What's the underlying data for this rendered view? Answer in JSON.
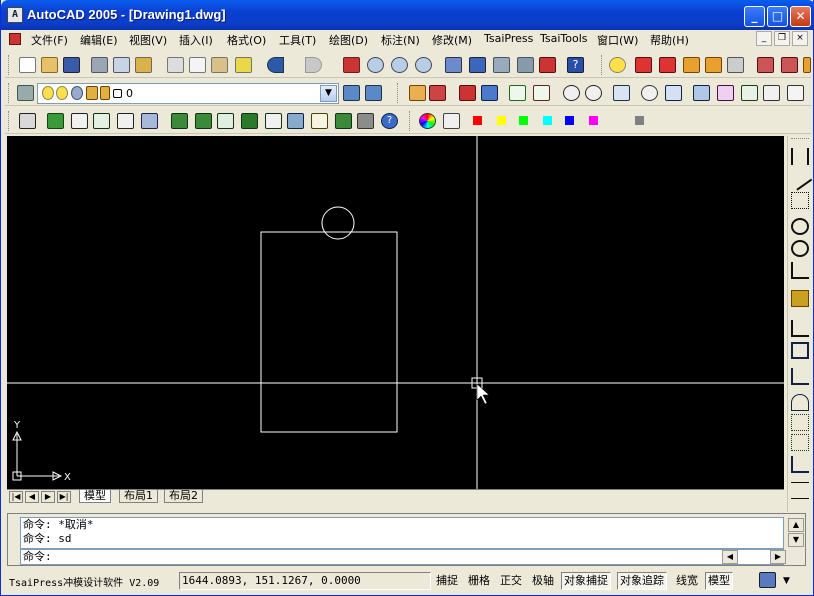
{
  "window": {
    "title": "AutoCAD 2005 - [Drawing1.dwg]",
    "app_icon": "autocad-icon"
  },
  "caption_buttons": {
    "minimize": "_",
    "maximize": "□",
    "close": "✕"
  },
  "menu": [
    "文件(F)",
    "编辑(E)",
    "视图(V)",
    "插入(I)",
    "格式(O)",
    "工具(T)",
    "绘图(D)",
    "标注(N)",
    "修改(M)",
    "TsaiPress",
    "TsaiTools",
    "窗口(W)",
    "帮助(H)"
  ],
  "mdi_buttons": {
    "minimize": "_",
    "restore": "❐",
    "close": "×"
  },
  "layer": {
    "current": "0"
  },
  "colors": {
    "swatches": [
      "#ff0000",
      "#ffff00",
      "#00ff00",
      "#00ffff",
      "#0000ff",
      "#ff00ff",
      "#808080"
    ],
    "canvas_bg": "#000000",
    "titlebar": "#0a4fd8"
  },
  "ucs": {
    "x_label": "X",
    "y_label": "Y"
  },
  "layout_tabs": [
    "模型",
    "布局1",
    "布局2"
  ],
  "command": {
    "history": [
      "命令: *取消*",
      "命令: sd"
    ],
    "prompt": "命令:"
  },
  "status": {
    "app_name": "TsaiPress冲模设计软件 V2.09",
    "coordinates": "1644.0893, 151.1267, 0.0000",
    "toggles": [
      {
        "label": "捕捉",
        "on": false
      },
      {
        "label": "栅格",
        "on": false
      },
      {
        "label": "正交",
        "on": false
      },
      {
        "label": "极轴",
        "on": false
      },
      {
        "label": "对象捕捉",
        "on": true
      },
      {
        "label": "对象追踪",
        "on": true
      },
      {
        "label": "线宽",
        "on": false
      },
      {
        "label": "模型",
        "on": true
      }
    ]
  }
}
